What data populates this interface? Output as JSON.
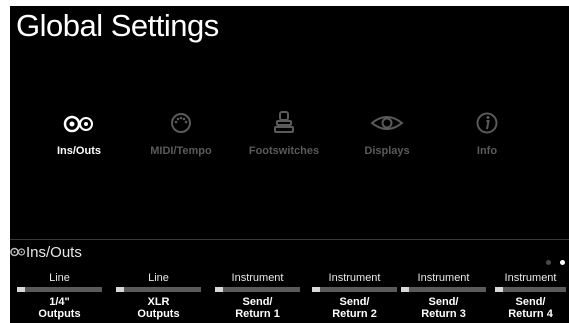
{
  "header": {
    "title": "Global Settings"
  },
  "categories": [
    {
      "label": "Ins/Outs",
      "icon": "ins-outs-icon",
      "active": true
    },
    {
      "label": "MIDI/Tempo",
      "icon": "midi-icon",
      "active": false
    },
    {
      "label": "Footswitches",
      "icon": "footswitch-icon",
      "active": false
    },
    {
      "label": "Displays",
      "icon": "display-icon",
      "active": false
    },
    {
      "label": "Info",
      "icon": "info-icon",
      "active": false
    }
  ],
  "section": {
    "title": "Ins/Outs",
    "page_count": 2,
    "current_page": 2
  },
  "params": [
    {
      "value": "Line",
      "name_line1": "1/4\"",
      "name_line2": "Outputs"
    },
    {
      "value": "Line",
      "name_line1": "XLR",
      "name_line2": "Outputs"
    },
    {
      "value": "Instrument",
      "name_line1": "Send/",
      "name_line2": "Return 1"
    },
    {
      "value": "Instrument",
      "name_line1": "Send/",
      "name_line2": "Return 2"
    },
    {
      "value": "Instrument",
      "name_line1": "Send/",
      "name_line2": "Return 3"
    },
    {
      "value": "Instrument",
      "name_line1": "Send/",
      "name_line2": "Return 4"
    }
  ],
  "colors": {
    "background": "#000000",
    "active": "#ffffff",
    "inactive": "#5a5a5a"
  }
}
